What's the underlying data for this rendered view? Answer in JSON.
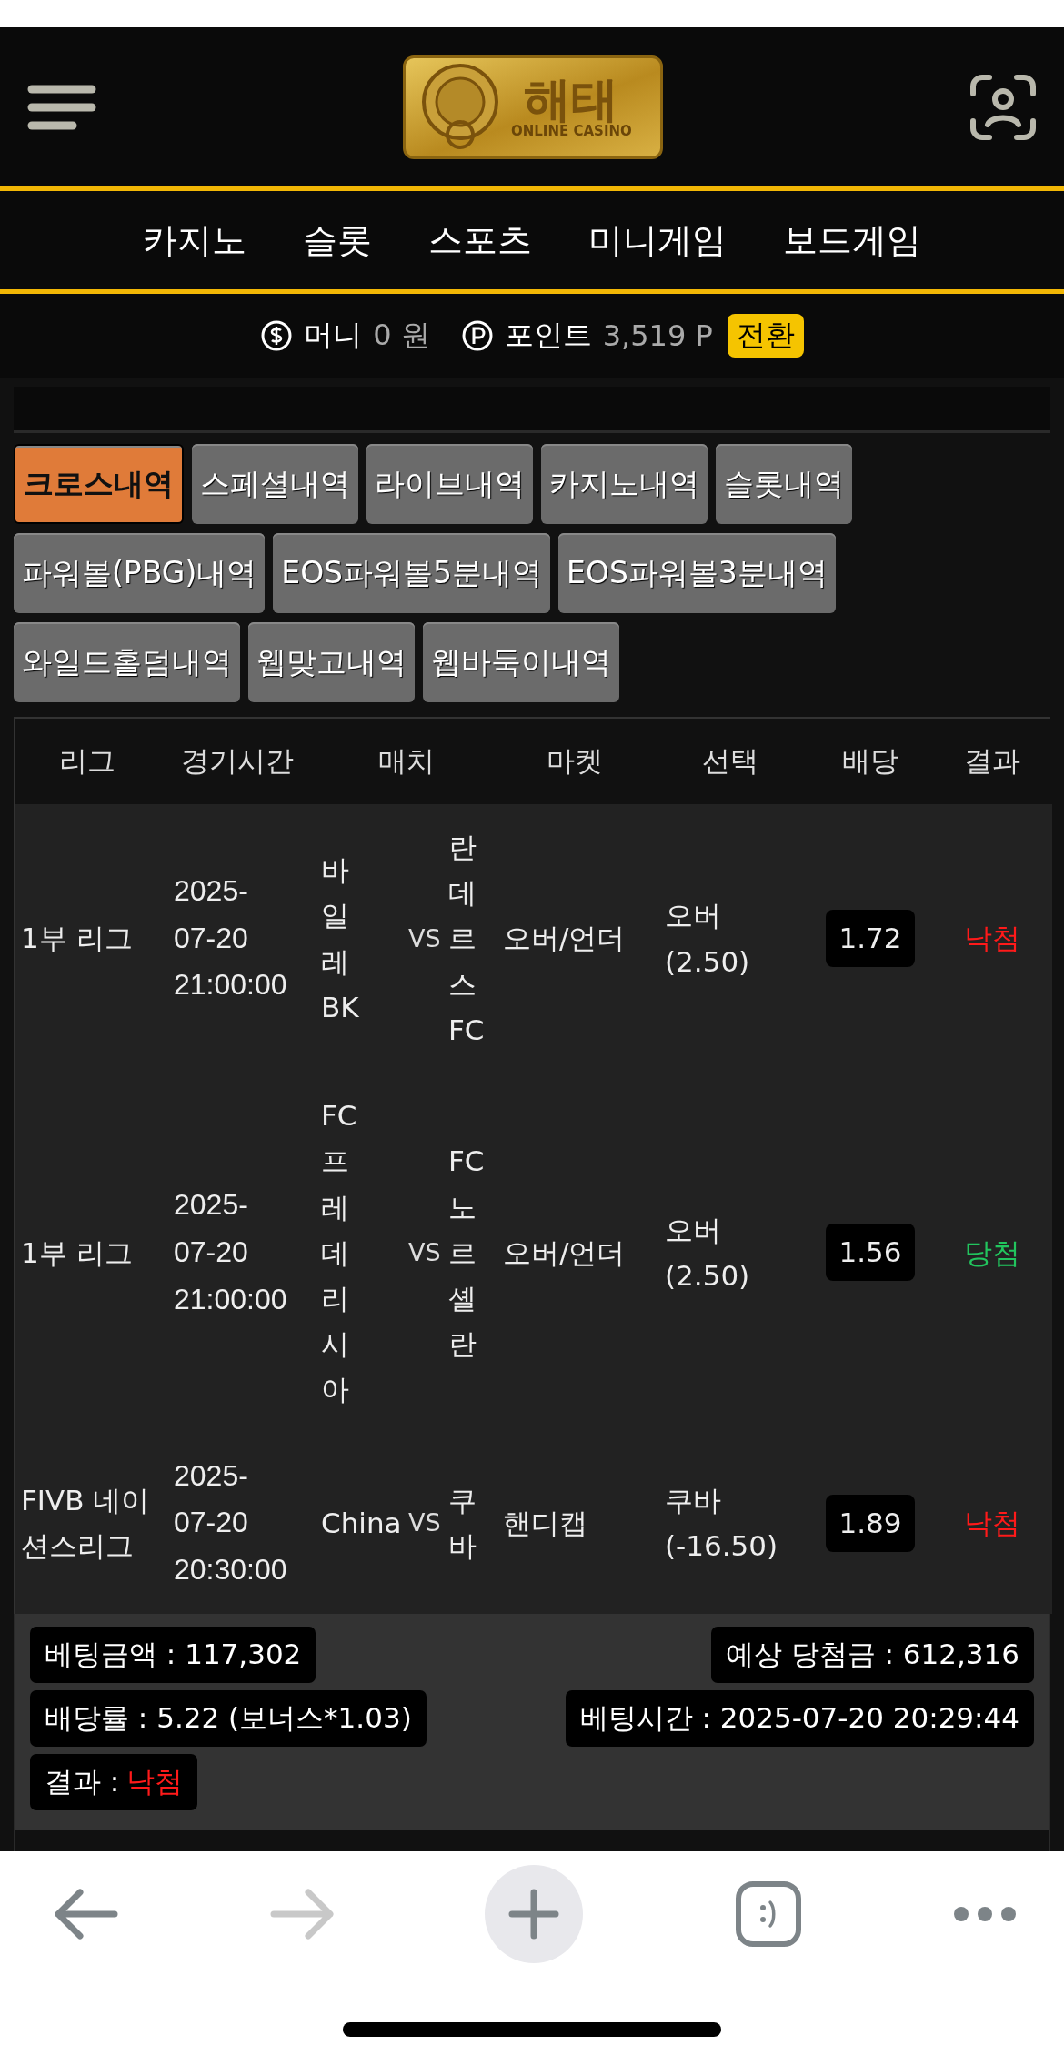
{
  "header": {
    "logo": {
      "title": "해태",
      "subtitle": "ONLINE CASINO"
    }
  },
  "nav": [
    {
      "label": "카지노"
    },
    {
      "label": "슬롯"
    },
    {
      "label": "스포츠"
    },
    {
      "label": "미니게임"
    },
    {
      "label": "보드게임"
    }
  ],
  "wallet": {
    "money_label": "머니",
    "money_value": "0 원",
    "point_label": "포인트",
    "point_value": "3,519 P",
    "convert_button": "전환"
  },
  "history_tabs": [
    {
      "label": "크로스내역",
      "selected": true
    },
    {
      "label": "스페셜내역",
      "selected": false
    },
    {
      "label": "라이브내역",
      "selected": false
    },
    {
      "label": "카지노내역",
      "selected": false
    },
    {
      "label": "슬롯내역",
      "selected": false
    },
    {
      "label": "파워볼(PBG)내역",
      "selected": false
    },
    {
      "label": "EOS파워볼5분내역",
      "selected": false
    },
    {
      "label": "EOS파워볼3분내역",
      "selected": false
    },
    {
      "label": "와일드홀덤내역",
      "selected": false
    },
    {
      "label": "웹맞고내역",
      "selected": false
    },
    {
      "label": "웹바둑이내역",
      "selected": false
    }
  ],
  "table": {
    "columns": [
      "리그",
      "경기시간",
      "매치",
      "마켓",
      "선택",
      "배당",
      "결과"
    ],
    "rows": [
      {
        "league": "1부 리그",
        "time": "2025-07-20 21:00:00",
        "home": "바일레BK",
        "vs": "VS",
        "away": "란데르스FC",
        "market": "오버/언더",
        "selection": "오버 (2.50)",
        "odds": "1.72",
        "result": "낙첨",
        "won": false
      },
      {
        "league": "1부 리그",
        "time": "2025-07-20 21:00:00",
        "home": "FC프레데리시아",
        "vs": "VS",
        "away": "FC노르셸란",
        "market": "오버/언더",
        "selection": "오버 (2.50)",
        "odds": "1.56",
        "result": "당첨",
        "won": true
      },
      {
        "league": "FIVB 네이션스리그",
        "time": "2025-07-20 20:30:00",
        "home": "China",
        "vs": "VS",
        "away": "쿠바",
        "market": "핸디캡",
        "selection": "쿠바 (-16.50)",
        "odds": "1.89",
        "result": "낙첨",
        "won": false
      }
    ]
  },
  "summary": {
    "bet_amount": "베팅금액 : 117,302",
    "expected_win": "예상 당첨금 : 612,316",
    "odds_rate": "배당률 : 5.22 (보너스*1.03)",
    "bet_time": "베팅시간 : 2025-07-20 20:29:44",
    "result_label": "결과 :",
    "result_value": "낙첨",
    "result_won": false
  },
  "browser_bar": {
    "back": {
      "disabled": false
    },
    "forward": {
      "disabled": true
    }
  }
}
